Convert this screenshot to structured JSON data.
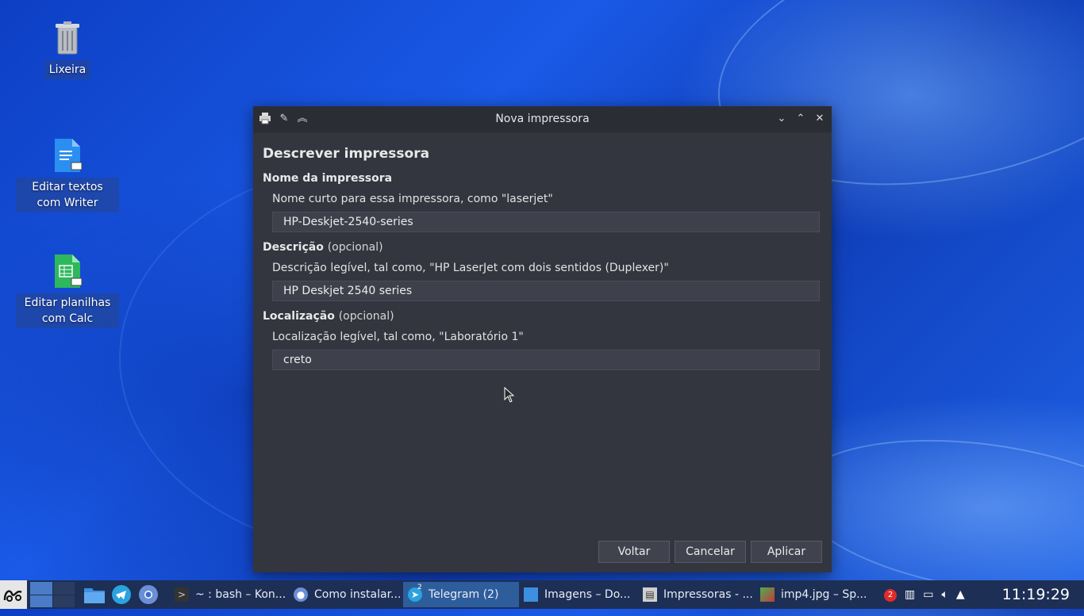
{
  "desktop": {
    "icons": [
      {
        "label": "Lixeira"
      },
      {
        "label": "Editar textos com Writer"
      },
      {
        "label": "Editar planilhas com Calc"
      }
    ]
  },
  "window": {
    "title": "Nova impressora",
    "heading": "Descrever impressora",
    "name_section": {
      "title": "Nome da impressora",
      "hint": "Nome curto para essa impressora, como \"laserjet\"",
      "value": "HP-Deskjet-2540-series"
    },
    "description_section": {
      "title": "Descrição",
      "optional": "(opcional)",
      "hint": "Descrição legível, tal como, \"HP LaserJet com dois sentidos (Duplexer)\"",
      "value": "HP Deskjet 2540 series"
    },
    "location_section": {
      "title": "Localização",
      "optional": "(opcional)",
      "hint": "Localização legível, tal como, \"Laboratório 1\"",
      "value": "creto"
    },
    "buttons": {
      "back": "Voltar",
      "cancel": "Cancelar",
      "apply": "Aplicar"
    }
  },
  "taskbar": {
    "tasks": [
      {
        "label": "~ : bash – Kon..."
      },
      {
        "label": "Como instalar..."
      },
      {
        "label": "Telegram (2)"
      },
      {
        "label": "Imagens – Do..."
      },
      {
        "label": "Impressoras - ..."
      },
      {
        "label": "imp4.jpg – Sp..."
      }
    ],
    "telegram_badge": "2",
    "tray_badge": "2",
    "clock": "11:19:29"
  },
  "colors": {
    "window_bg": "#33353f",
    "titlebar_bg": "#2b2d35",
    "taskbar_bg": "#1d2f55",
    "active_task": "#2e5d9c"
  }
}
